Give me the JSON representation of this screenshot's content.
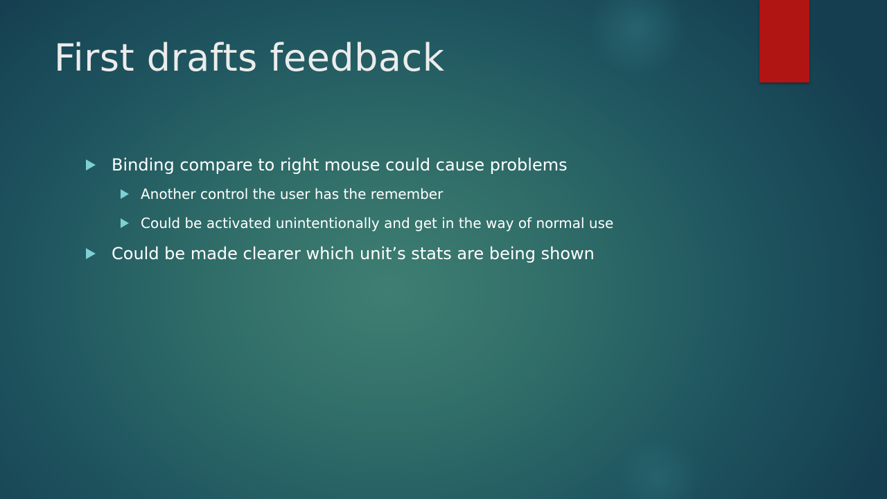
{
  "slide": {
    "title": "First drafts feedback",
    "accent_color": "#b01513",
    "bullet_color": "#7dd0d4",
    "bullets": [
      {
        "text": "Binding compare to right mouse could cause problems",
        "sub": [
          "Another control the user has the remember",
          "Could be activated unintentionally and get in the way of normal use"
        ]
      },
      {
        "text": "Could be made clearer which unit’s stats are being shown"
      }
    ],
    "bullet_icon": "triangle-right-icon"
  }
}
